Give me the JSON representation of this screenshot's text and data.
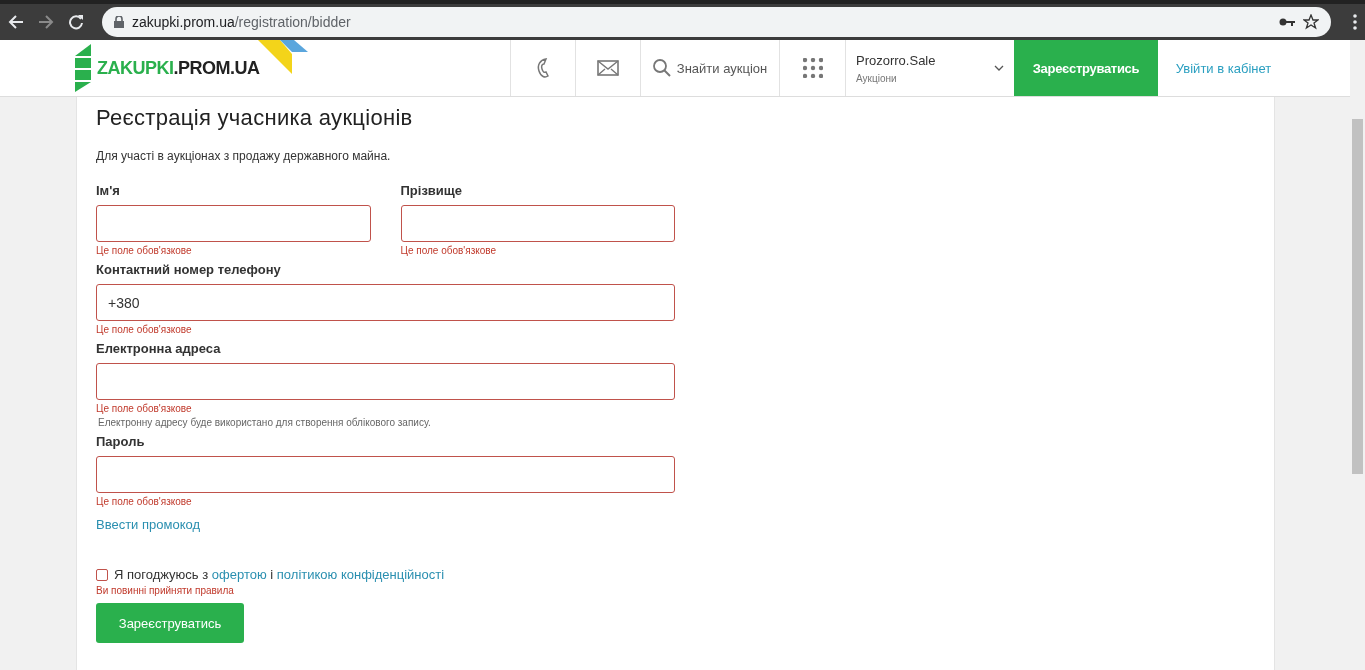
{
  "browser": {
    "url_host": "zakupki.prom.ua",
    "url_path": "/registration/bidder"
  },
  "header": {
    "logo_first": "ZAKUPKI",
    "logo_second": ".PROM.UA",
    "search_label": "Знайти аукціон",
    "platform": {
      "name": "Prozorro.Sale",
      "subtitle": "Аукціони"
    },
    "register_button": "Зареєструватись",
    "login_link": "Увійти в кабінет"
  },
  "form": {
    "title": "Реєстрація учасника аукціонів",
    "subtitle": "Для участі в аукціонах з продажу державного майна.",
    "rows": [
      {
        "fields": [
          {
            "label": "Ім'я",
            "invalid": true,
            "error": "Це поле обов'язкове"
          },
          {
            "label": "Прізвище",
            "invalid": true,
            "error": "Це поле обов'язкове"
          }
        ]
      },
      {
        "fields": [
          {
            "label": "Контактний номер телефону",
            "value": "+380",
            "invalid": true,
            "error": "Це поле обов'язкове"
          }
        ]
      },
      {
        "fields": [
          {
            "label": "Електронна адреса",
            "invalid": true,
            "error": "Це поле обов'язкове",
            "hint": "Електронну адресу буде використано для створення облікового запису."
          }
        ]
      },
      {
        "fields": [
          {
            "label": "Пароль",
            "invalid": true,
            "error": "Це поле обов'язкове"
          }
        ]
      }
    ],
    "promo_link": "Ввести промокод",
    "agreement": {
      "checked": false,
      "parts": [
        {
          "kind": "text",
          "text": "Я погоджуюсь з "
        },
        {
          "kind": "link",
          "text": "офертою"
        },
        {
          "kind": "text",
          "text": " і "
        },
        {
          "kind": "link",
          "text": "політикою конфіденційності"
        }
      ],
      "error": "Ви повинні прийняти правила"
    },
    "submit": "Зареєструватись"
  }
}
